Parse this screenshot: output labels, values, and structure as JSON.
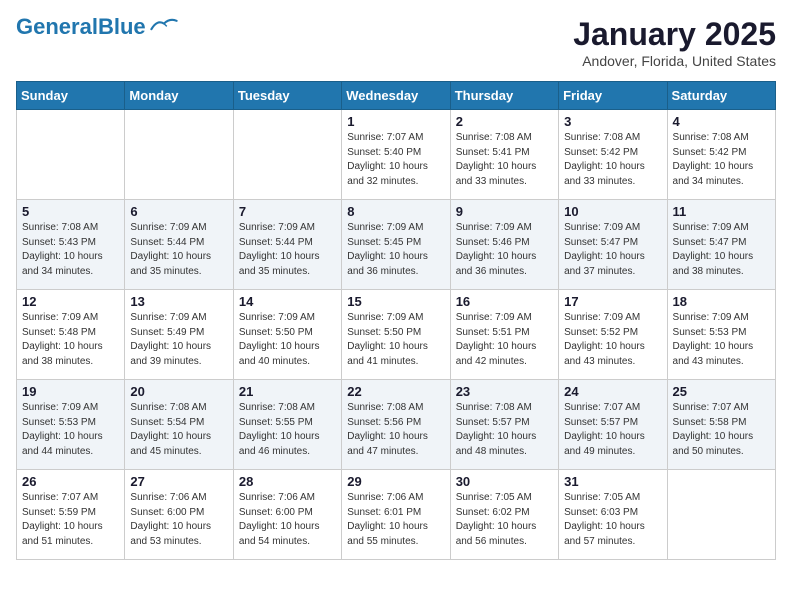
{
  "header": {
    "logo_general": "General",
    "logo_blue": "Blue",
    "month_title": "January 2025",
    "location": "Andover, Florida, United States"
  },
  "days_of_week": [
    "Sunday",
    "Monday",
    "Tuesday",
    "Wednesday",
    "Thursday",
    "Friday",
    "Saturday"
  ],
  "weeks": [
    [
      {
        "day": "",
        "info": ""
      },
      {
        "day": "",
        "info": ""
      },
      {
        "day": "",
        "info": ""
      },
      {
        "day": "1",
        "info": "Sunrise: 7:07 AM\nSunset: 5:40 PM\nDaylight: 10 hours\nand 32 minutes."
      },
      {
        "day": "2",
        "info": "Sunrise: 7:08 AM\nSunset: 5:41 PM\nDaylight: 10 hours\nand 33 minutes."
      },
      {
        "day": "3",
        "info": "Sunrise: 7:08 AM\nSunset: 5:42 PM\nDaylight: 10 hours\nand 33 minutes."
      },
      {
        "day": "4",
        "info": "Sunrise: 7:08 AM\nSunset: 5:42 PM\nDaylight: 10 hours\nand 34 minutes."
      }
    ],
    [
      {
        "day": "5",
        "info": "Sunrise: 7:08 AM\nSunset: 5:43 PM\nDaylight: 10 hours\nand 34 minutes."
      },
      {
        "day": "6",
        "info": "Sunrise: 7:09 AM\nSunset: 5:44 PM\nDaylight: 10 hours\nand 35 minutes."
      },
      {
        "day": "7",
        "info": "Sunrise: 7:09 AM\nSunset: 5:44 PM\nDaylight: 10 hours\nand 35 minutes."
      },
      {
        "day": "8",
        "info": "Sunrise: 7:09 AM\nSunset: 5:45 PM\nDaylight: 10 hours\nand 36 minutes."
      },
      {
        "day": "9",
        "info": "Sunrise: 7:09 AM\nSunset: 5:46 PM\nDaylight: 10 hours\nand 36 minutes."
      },
      {
        "day": "10",
        "info": "Sunrise: 7:09 AM\nSunset: 5:47 PM\nDaylight: 10 hours\nand 37 minutes."
      },
      {
        "day": "11",
        "info": "Sunrise: 7:09 AM\nSunset: 5:47 PM\nDaylight: 10 hours\nand 38 minutes."
      }
    ],
    [
      {
        "day": "12",
        "info": "Sunrise: 7:09 AM\nSunset: 5:48 PM\nDaylight: 10 hours\nand 38 minutes."
      },
      {
        "day": "13",
        "info": "Sunrise: 7:09 AM\nSunset: 5:49 PM\nDaylight: 10 hours\nand 39 minutes."
      },
      {
        "day": "14",
        "info": "Sunrise: 7:09 AM\nSunset: 5:50 PM\nDaylight: 10 hours\nand 40 minutes."
      },
      {
        "day": "15",
        "info": "Sunrise: 7:09 AM\nSunset: 5:50 PM\nDaylight: 10 hours\nand 41 minutes."
      },
      {
        "day": "16",
        "info": "Sunrise: 7:09 AM\nSunset: 5:51 PM\nDaylight: 10 hours\nand 42 minutes."
      },
      {
        "day": "17",
        "info": "Sunrise: 7:09 AM\nSunset: 5:52 PM\nDaylight: 10 hours\nand 43 minutes."
      },
      {
        "day": "18",
        "info": "Sunrise: 7:09 AM\nSunset: 5:53 PM\nDaylight: 10 hours\nand 43 minutes."
      }
    ],
    [
      {
        "day": "19",
        "info": "Sunrise: 7:09 AM\nSunset: 5:53 PM\nDaylight: 10 hours\nand 44 minutes."
      },
      {
        "day": "20",
        "info": "Sunrise: 7:08 AM\nSunset: 5:54 PM\nDaylight: 10 hours\nand 45 minutes."
      },
      {
        "day": "21",
        "info": "Sunrise: 7:08 AM\nSunset: 5:55 PM\nDaylight: 10 hours\nand 46 minutes."
      },
      {
        "day": "22",
        "info": "Sunrise: 7:08 AM\nSunset: 5:56 PM\nDaylight: 10 hours\nand 47 minutes."
      },
      {
        "day": "23",
        "info": "Sunrise: 7:08 AM\nSunset: 5:57 PM\nDaylight: 10 hours\nand 48 minutes."
      },
      {
        "day": "24",
        "info": "Sunrise: 7:07 AM\nSunset: 5:57 PM\nDaylight: 10 hours\nand 49 minutes."
      },
      {
        "day": "25",
        "info": "Sunrise: 7:07 AM\nSunset: 5:58 PM\nDaylight: 10 hours\nand 50 minutes."
      }
    ],
    [
      {
        "day": "26",
        "info": "Sunrise: 7:07 AM\nSunset: 5:59 PM\nDaylight: 10 hours\nand 51 minutes."
      },
      {
        "day": "27",
        "info": "Sunrise: 7:06 AM\nSunset: 6:00 PM\nDaylight: 10 hours\nand 53 minutes."
      },
      {
        "day": "28",
        "info": "Sunrise: 7:06 AM\nSunset: 6:00 PM\nDaylight: 10 hours\nand 54 minutes."
      },
      {
        "day": "29",
        "info": "Sunrise: 7:06 AM\nSunset: 6:01 PM\nDaylight: 10 hours\nand 55 minutes."
      },
      {
        "day": "30",
        "info": "Sunrise: 7:05 AM\nSunset: 6:02 PM\nDaylight: 10 hours\nand 56 minutes."
      },
      {
        "day": "31",
        "info": "Sunrise: 7:05 AM\nSunset: 6:03 PM\nDaylight: 10 hours\nand 57 minutes."
      },
      {
        "day": "",
        "info": ""
      }
    ]
  ]
}
